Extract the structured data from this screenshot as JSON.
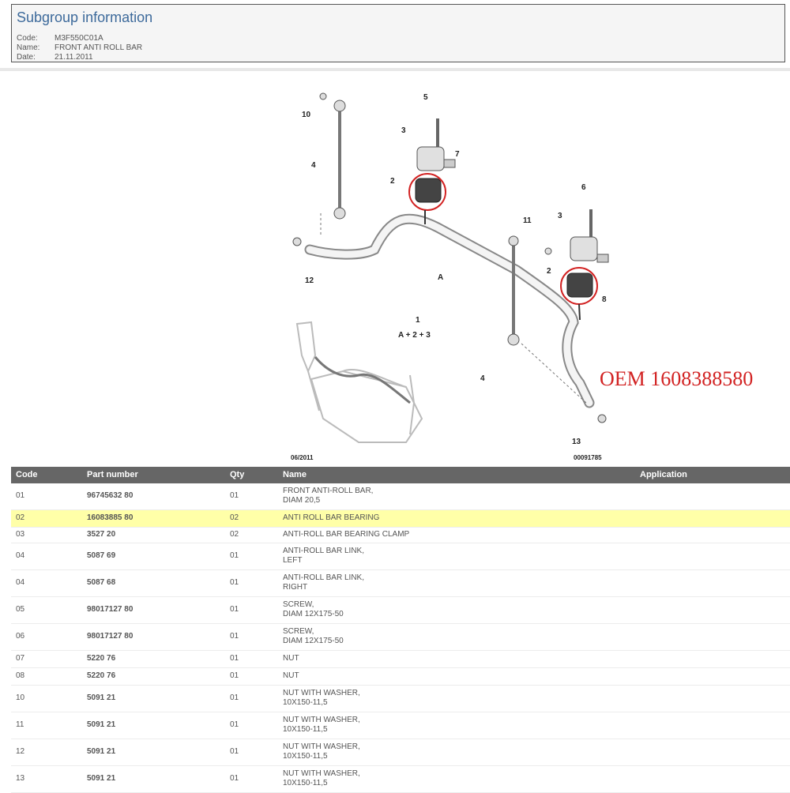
{
  "header": {
    "title": "Subgroup information",
    "code_label": "Code:",
    "code_value": "M3F550C01A",
    "name_label": "Name:",
    "name_value": "FRONT ANTI ROLL BAR",
    "date_label": "Date:",
    "date_value": "21.11.2011"
  },
  "diagram": {
    "callouts": [
      "10",
      "4",
      "5",
      "3",
      "7",
      "2",
      "A",
      "12",
      "11",
      "6",
      "3",
      "2",
      "8",
      "1",
      "A + 2 + 3",
      "4",
      "13"
    ],
    "date_stamp": "06/2011",
    "ref_number": "00091785",
    "oem_note": "OEM   1608388580"
  },
  "table": {
    "headers": {
      "code": "Code",
      "part": "Part number",
      "qty": "Qty",
      "name": "Name",
      "application": "Application"
    },
    "rows": [
      {
        "code": "01",
        "part": "96745632 80",
        "qty": "01",
        "name1": "FRONT ANTI-ROLL BAR,",
        "name2": "DIAM 20,5"
      },
      {
        "code": "02",
        "part": "16083885 80",
        "qty": "02",
        "name1": "ANTI ROLL BAR BEARING",
        "name2": ""
      },
      {
        "code": "03",
        "part": "3527 20",
        "qty": "02",
        "name1": "ANTI-ROLL BAR BEARING CLAMP",
        "name2": ""
      },
      {
        "code": "04",
        "part": "5087 69",
        "qty": "01",
        "name1": "ANTI-ROLL BAR LINK,",
        "name2": "LEFT"
      },
      {
        "code": "04",
        "part": "5087 68",
        "qty": "01",
        "name1": "ANTI-ROLL BAR LINK,",
        "name2": "RIGHT"
      },
      {
        "code": "05",
        "part": "98017127 80",
        "qty": "01",
        "name1": "SCREW,",
        "name2": "DIAM 12X175-50"
      },
      {
        "code": "06",
        "part": "98017127 80",
        "qty": "01",
        "name1": "SCREW,",
        "name2": "DIAM 12X175-50"
      },
      {
        "code": "07",
        "part": "5220 76",
        "qty": "01",
        "name1": "NUT",
        "name2": ""
      },
      {
        "code": "08",
        "part": "5220 76",
        "qty": "01",
        "name1": "NUT",
        "name2": ""
      },
      {
        "code": "10",
        "part": "5091 21",
        "qty": "01",
        "name1": "NUT WITH WASHER,",
        "name2": "10X150-11,5"
      },
      {
        "code": "11",
        "part": "5091 21",
        "qty": "01",
        "name1": "NUT WITH WASHER,",
        "name2": "10X150-11,5"
      },
      {
        "code": "12",
        "part": "5091 21",
        "qty": "01",
        "name1": "NUT WITH WASHER,",
        "name2": "10X150-11,5"
      },
      {
        "code": "13",
        "part": "5091 21",
        "qty": "01",
        "name1": "NUT WITH WASHER,",
        "name2": "10X150-11,5"
      }
    ]
  },
  "colors": {
    "header_title": "#3d6a9b",
    "table_header_bg": "#666666",
    "highlight_row": "#ffffa8",
    "oem_text": "#d22222"
  }
}
